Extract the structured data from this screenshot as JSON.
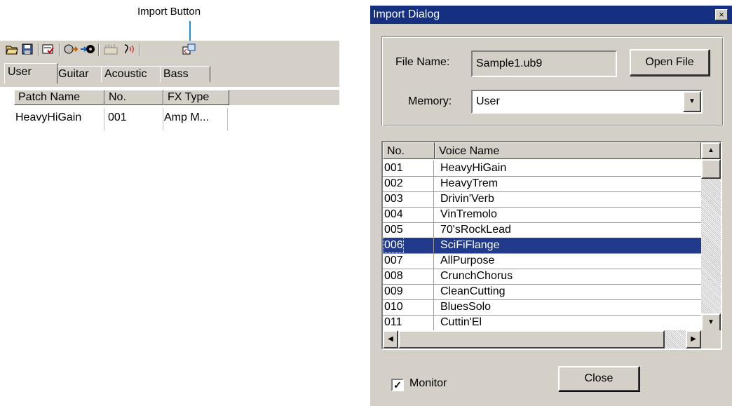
{
  "annotation": {
    "label": "Import Button"
  },
  "toolbar": {
    "icons": [
      "open-folder",
      "save",
      "patch-edit",
      "transfer-send",
      "transfer-receive",
      "edit-all",
      "audition",
      "import"
    ]
  },
  "library": {
    "tabs": [
      "User",
      "Guitar",
      "Acoustic",
      "Bass"
    ],
    "columns": [
      "Patch Name",
      "No.",
      "FX Type"
    ],
    "rows": [
      {
        "name": "HeavyHiGain",
        "no": "001",
        "fx": "Amp M..."
      }
    ]
  },
  "dialog": {
    "title": "Import Dialog",
    "close_glyph": "×",
    "file_name_label": "File Name:",
    "file_name_value": "Sample1.ub9",
    "open_file_button": "Open File",
    "memory_label": "Memory:",
    "memory_value": "User",
    "columns": [
      "No.",
      "Voice Name"
    ],
    "rows": [
      {
        "no": "001",
        "name": "HeavyHiGain"
      },
      {
        "no": "002",
        "name": "HeavyTrem"
      },
      {
        "no": "003",
        "name": "Drivin'Verb"
      },
      {
        "no": "004",
        "name": "VinTremolo"
      },
      {
        "no": "005",
        "name": "70'sRockLead"
      },
      {
        "no": "006",
        "name": "SciFiFlange"
      },
      {
        "no": "007",
        "name": "AllPurpose"
      },
      {
        "no": "008",
        "name": "CrunchChorus"
      },
      {
        "no": "009",
        "name": "CleanCutting"
      },
      {
        "no": "010",
        "name": "BluesSolo"
      },
      {
        "no": "011",
        "name": "Cuttin'El"
      }
    ],
    "selected_row": "006",
    "monitor_label": "Monitor",
    "monitor_checked": true,
    "close_button": "Close"
  },
  "colors": {
    "title_bar": "#153080",
    "selection": "#223a8c",
    "face": "#d4d0c8",
    "annotation_line": "#1a8fd6"
  }
}
